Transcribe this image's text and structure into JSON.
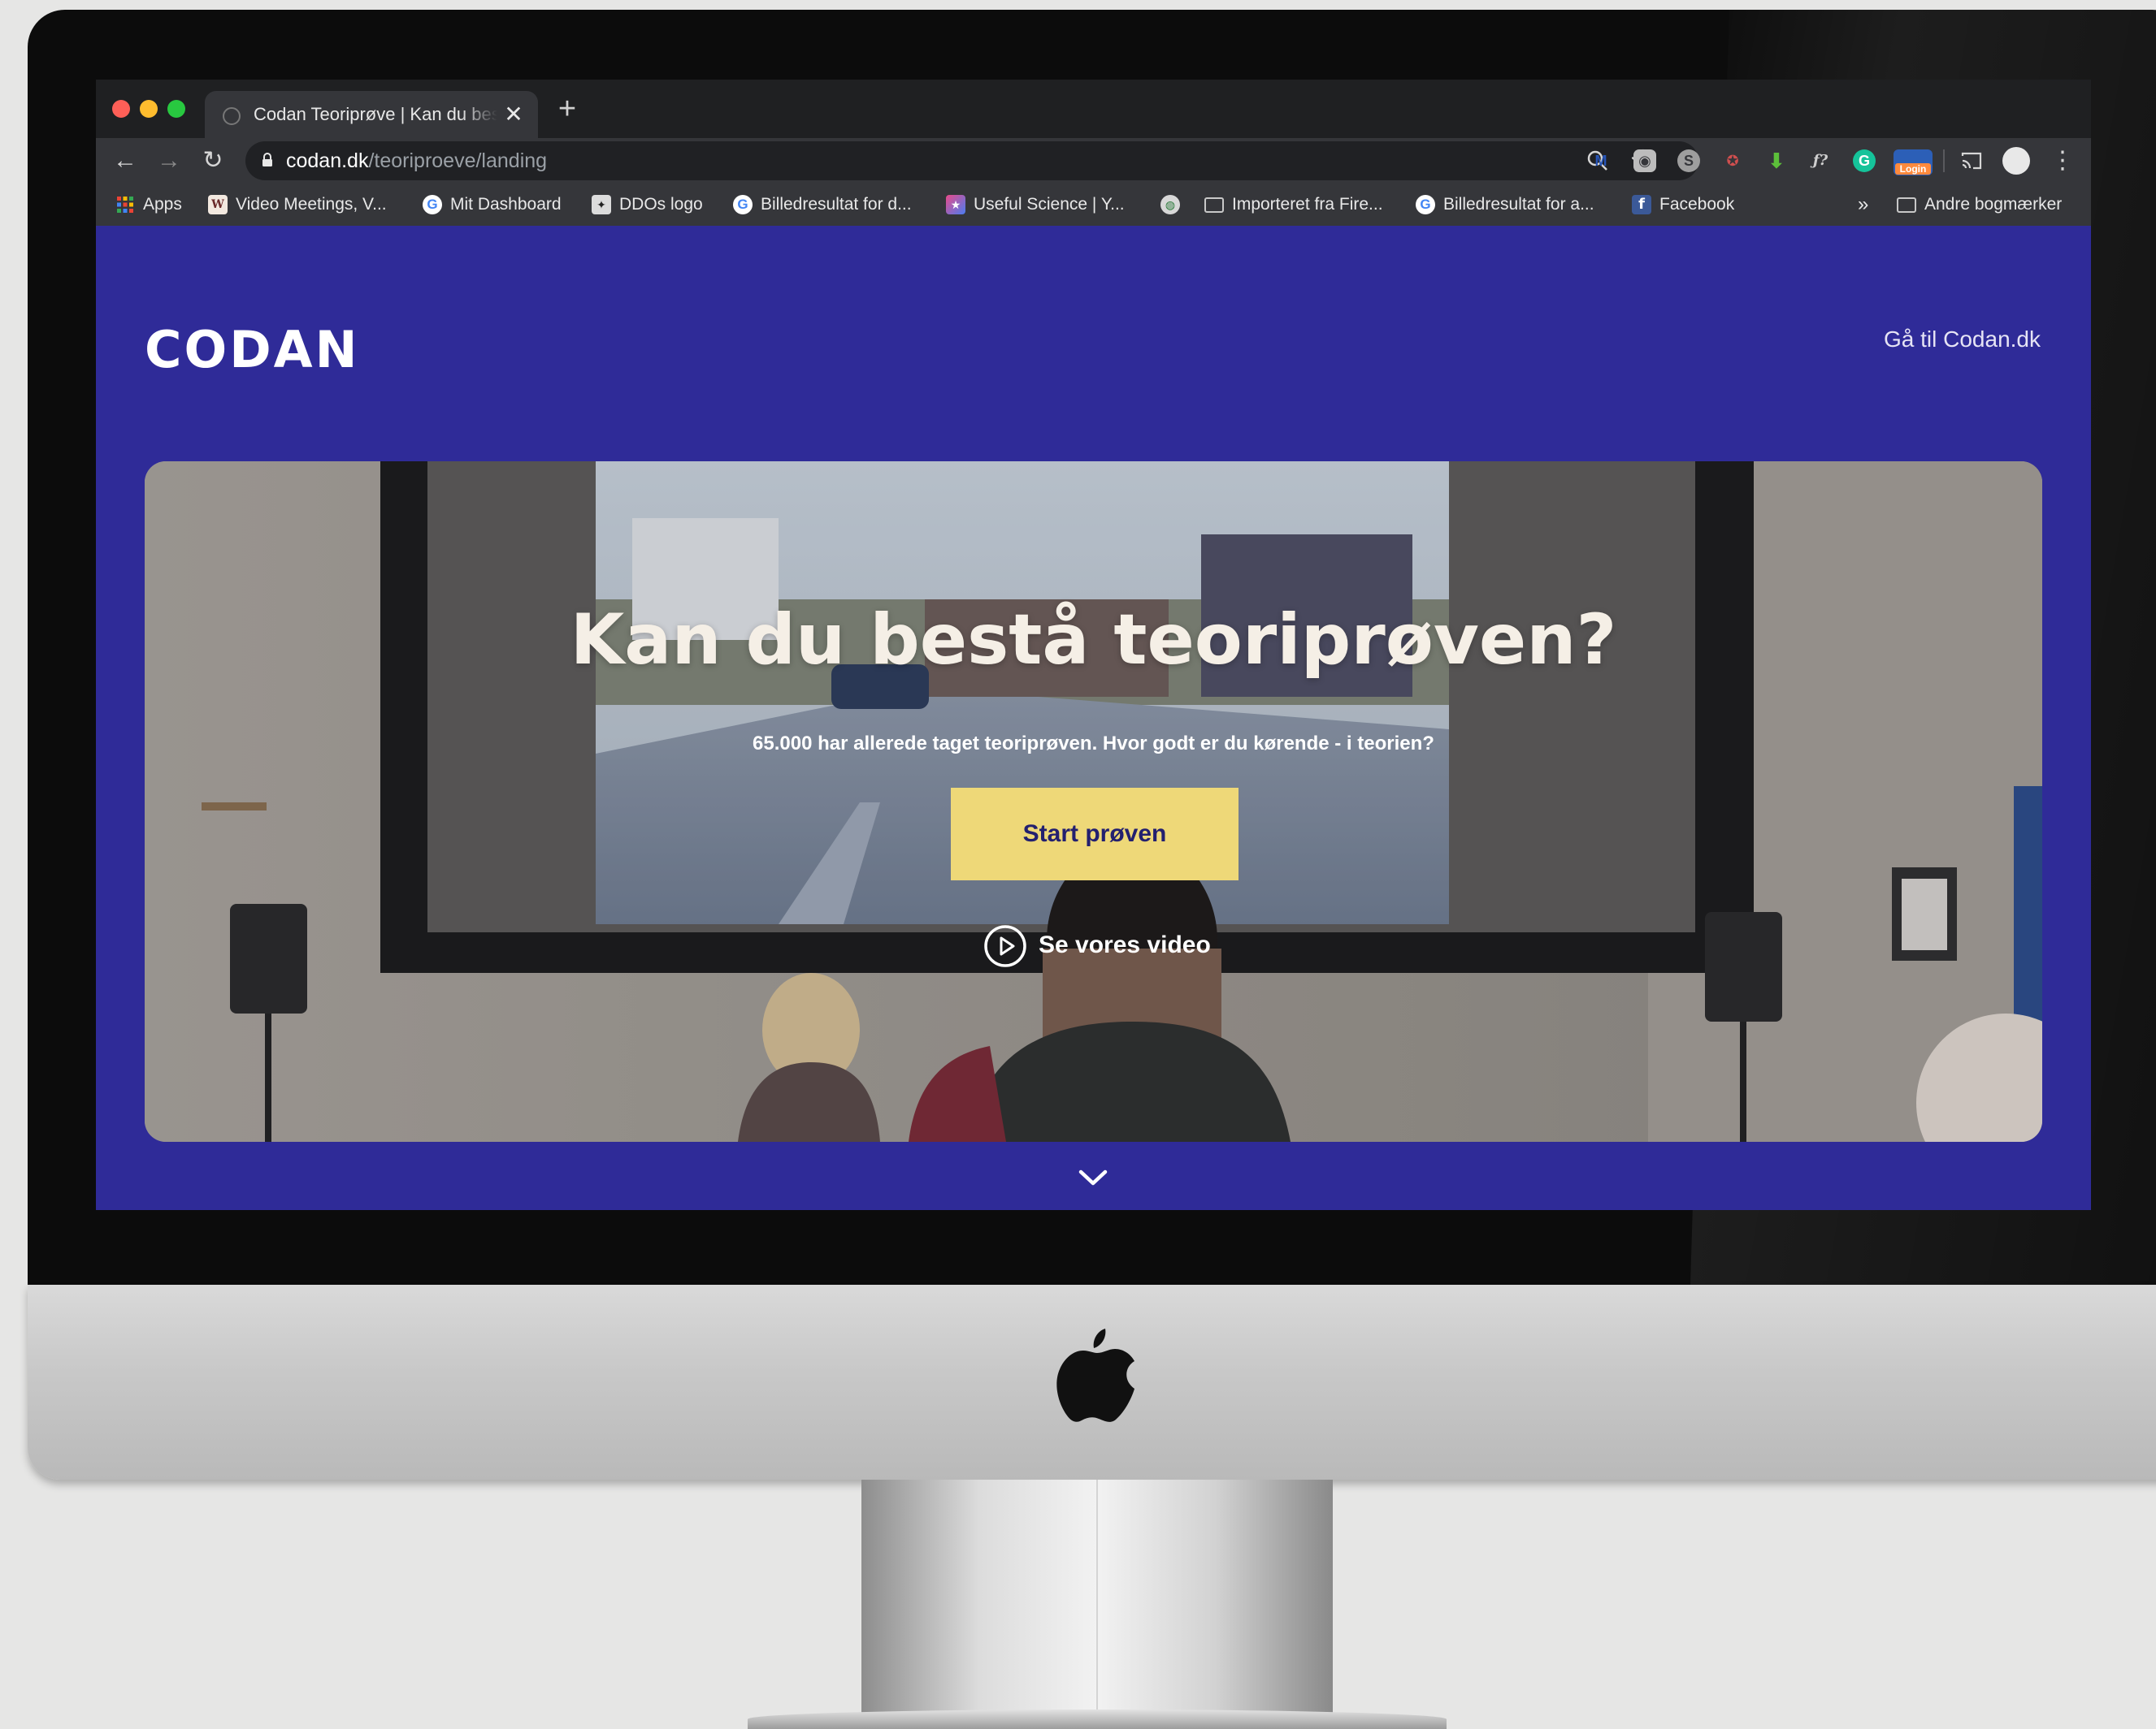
{
  "browser": {
    "tab_title": "Codan Teoriprøve | Kan du bestå teoriprøven?",
    "tab_close": "✕",
    "new_tab": "+",
    "url_host": "codan.dk",
    "url_path": "/teoriproeve/landing",
    "nav": {
      "back": "←",
      "forward": "→",
      "reload": "↻",
      "menu": "⋮"
    },
    "bookmarks": [
      {
        "label": "Apps",
        "icon": "apps-grid-icon"
      },
      {
        "label": "Video Meetings, V...",
        "icon": "whereby-icon"
      },
      {
        "label": "Mit Dashboard",
        "icon": "google-icon"
      },
      {
        "label": "DDOs logo",
        "icon": "ddos-icon"
      },
      {
        "label": "Billedresultat for d...",
        "icon": "google-icon"
      },
      {
        "label": "Useful Science | Y...",
        "icon": "useful-science-icon"
      },
      {
        "label": "Importeret fra Fire...",
        "icon": "folder-icon"
      },
      {
        "label": "Billedresultat for a...",
        "icon": "google-icon"
      },
      {
        "label": "Facebook",
        "icon": "facebook-icon"
      }
    ],
    "bookmarks_overflow": "»",
    "other_bookmarks": "Andre bogmærker",
    "extension_login_badge": "Login"
  },
  "page": {
    "logo": "CODAN",
    "goto_link": "Gå til Codan.dk",
    "headline": "Kan du bestå teoriprøven?",
    "subline": "65.000 har allerede taget teoriprøven. Hvor godt er du kørende - i teorien?",
    "cta": "Start prøven",
    "video_link": "Se vores video"
  },
  "colors": {
    "brand_blue": "#2f2b98",
    "cta_yellow": "#eed878",
    "cta_text": "#23206f"
  }
}
